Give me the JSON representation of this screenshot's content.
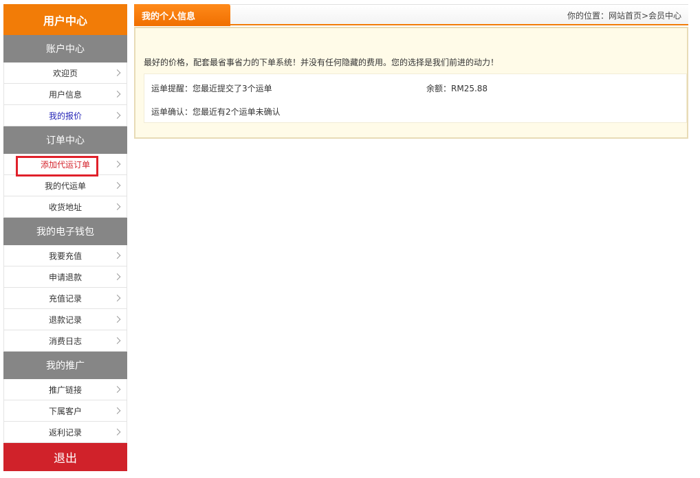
{
  "sidebar": {
    "title": "用户中心",
    "groups": [
      {
        "label": "账户中心",
        "items": [
          {
            "label": "欢迎页"
          },
          {
            "label": "用户信息"
          },
          {
            "label": "我的报价"
          }
        ]
      },
      {
        "label": "订单中心",
        "items": [
          {
            "label": "添加代运订单"
          },
          {
            "label": "我的代运单"
          },
          {
            "label": "收货地址"
          }
        ]
      },
      {
        "label": "我的电子钱包",
        "items": [
          {
            "label": "我要充值"
          },
          {
            "label": "申请退款"
          },
          {
            "label": "充值记录"
          },
          {
            "label": "退款记录"
          },
          {
            "label": "消费日志"
          }
        ]
      },
      {
        "label": "我的推广",
        "items": [
          {
            "label": "推广链接"
          },
          {
            "label": "下属客户"
          },
          {
            "label": "返利记录"
          }
        ]
      }
    ],
    "logout_label": "退出"
  },
  "main": {
    "tab_title": "我的个人信息",
    "location": "你的位置：网站首页>会员中心",
    "welcome": "最好的价格，配套最省事省力的下单系统！并没有任何隐藏的费用。您的选择是我们前进的动力！",
    "stats": {
      "orders_submitted": "运单提醒：您最近提交了3个运单",
      "balance": "余额：RM25.88",
      "orders_unconfirmed": "运单确认：您最近有2个运单未确认"
    }
  },
  "colors": {
    "accent": "#f27c07",
    "group_header": "#868686",
    "logout": "#d0222a",
    "link_blue": "#2424b6",
    "link_red": "#d4222a",
    "panel_bg": "#fffbe8"
  }
}
